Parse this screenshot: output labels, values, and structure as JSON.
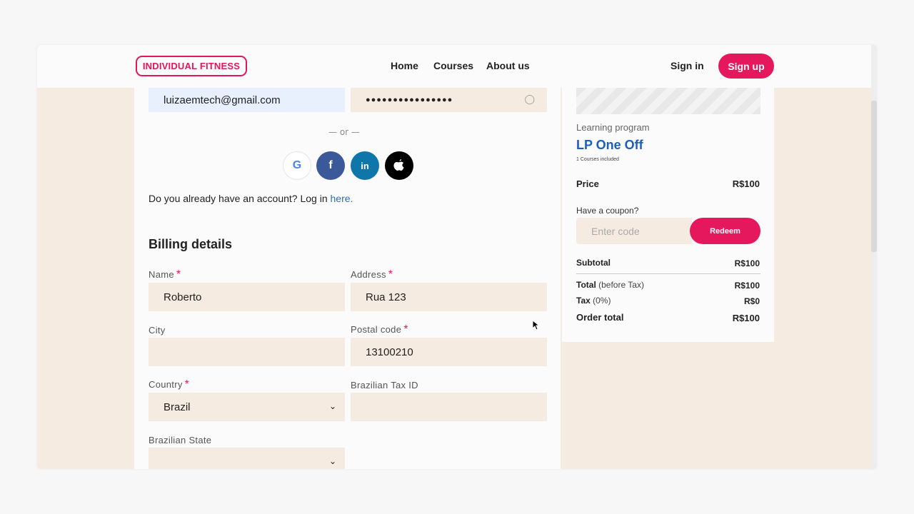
{
  "header": {
    "logo": "INDIVIDUAL FITNESS",
    "nav": [
      "Home",
      "Courses",
      "About us"
    ],
    "signin": "Sign in",
    "signup": "Sign up"
  },
  "login": {
    "email_value": "luizaemtech@gmail.com",
    "password_mask": "●●●●●●●●●●●●●●●●",
    "or": "— or —",
    "already_text": "Do you already have an account? Log in ",
    "here_link": "here."
  },
  "social": {
    "google": "G",
    "facebook": "f",
    "linkedin": "in",
    "apple": ""
  },
  "billing": {
    "title": "Billing details",
    "name_label": "Name",
    "name_value": "Roberto",
    "address_label": "Address",
    "address_value": "Rua 123",
    "city_label": "City",
    "city_value": "",
    "postal_label": "Postal code",
    "postal_value": "13100210",
    "country_label": "Country",
    "country_value": "Brazil",
    "taxid_label": "Brazilian Tax ID",
    "taxid_value": "",
    "state_label": "Brazilian State",
    "state_value": "",
    "required_mark": "*"
  },
  "summary": {
    "program_label": "Learning program",
    "program_name": "LP One Off",
    "courses_included": "1 Courses included",
    "price_label": "Price",
    "price_value": "R$100",
    "coupon_label": "Have a coupon?",
    "coupon_placeholder": "Enter code",
    "redeem": "Redeem",
    "subtotal_label": "Subtotal",
    "subtotal_value": "R$100",
    "total_label": "Total",
    "total_note": "(before Tax)",
    "total_value": "R$100",
    "tax_label": "Tax",
    "tax_note": "(0%)",
    "tax_value": "R$0",
    "order_total_label": "Order total",
    "order_total_value": "R$100"
  },
  "colors": {
    "brand": "#e5185e",
    "field_bg": "#f5ebe0",
    "link": "#2d6fb4",
    "program_title": "#1c5fb8",
    "facebook": "#3b5998",
    "linkedin": "#0e76a8",
    "apple": "#000000"
  }
}
